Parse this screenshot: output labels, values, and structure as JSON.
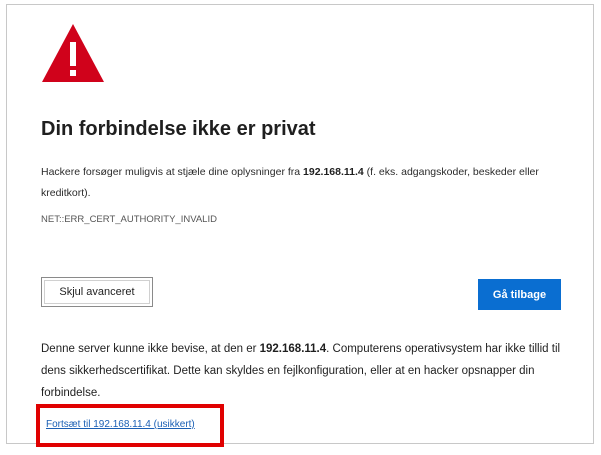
{
  "page": {
    "title": "Din forbindelse ikke er privat",
    "desc_before": "Hackere forsøger muligvis at stjæle dine oplysninger fra ",
    "host": "192.168.11.4",
    "desc_after": " (f. eks. adgangskoder, beskeder eller kreditkort).",
    "error_code": "NET::ERR_CERT_AUTHORITY_INVALID"
  },
  "buttons": {
    "hide_advanced": "Skjul avanceret",
    "go_back": "Gå tilbage"
  },
  "advanced": {
    "text_before": "Denne server kunne ikke bevise, at den er ",
    "host": "192.168.11.4",
    "text_after": ". Computerens operativsystem har ikke tillid til dens sikkerhedscertifikat. Dette kan skyldes en fejlkonfiguration, eller at en hacker opsnapper din forbindelse.",
    "proceed_link": "Fortsæt til 192.168.11.4 (usikkert)"
  },
  "icons": {
    "warning": "warning-triangle-icon"
  },
  "colors": {
    "warning_red": "#d0021b",
    "button_blue": "#0a6ed1",
    "link_blue": "#1a5fb4",
    "highlight_red": "#e00000"
  }
}
